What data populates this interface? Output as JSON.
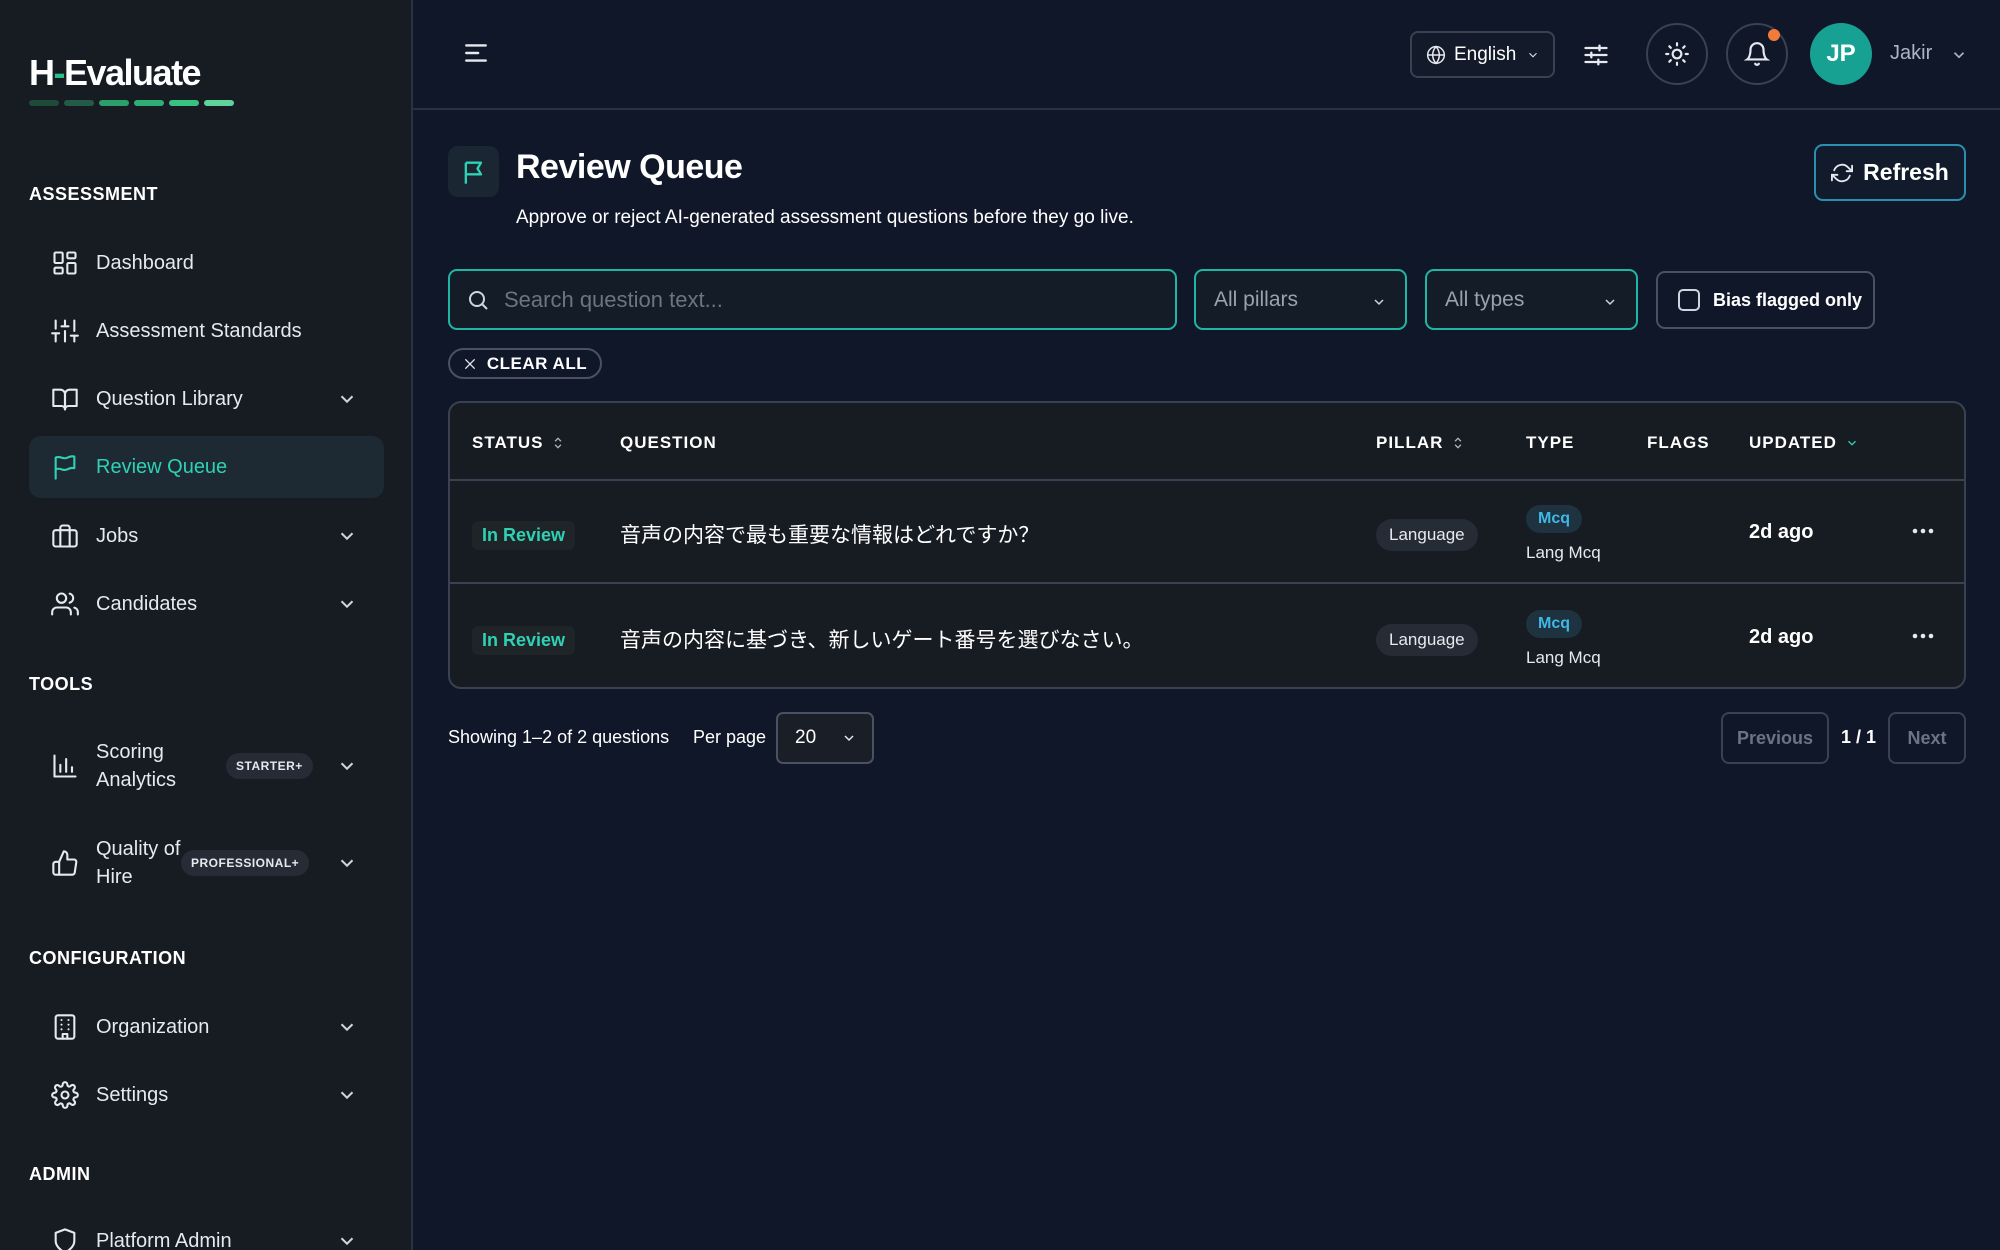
{
  "app": {
    "logo_main": "H",
    "logo_dash": "-",
    "logo_rest": "Evaluate",
    "logo_bar_colors": [
      "#1e4a3a",
      "#235c46",
      "#2a9e6b",
      "#2eae75",
      "#38c283",
      "#5ed39b"
    ]
  },
  "sidebar": {
    "sections": {
      "assessment": "ASSESSMENT",
      "tools": "TOOLS",
      "configuration": "CONFIGURATION",
      "admin": "ADMIN"
    },
    "items": {
      "dashboard": "Dashboard",
      "assessment_standards": "Assessment Standards",
      "question_library": "Question Library",
      "review_queue": "Review Queue",
      "jobs": "Jobs",
      "candidates": "Candidates",
      "scoring_analytics": "Scoring Analytics",
      "scoring_badge": "STARTER+",
      "quality_of_hire": "Quality of Hire",
      "quality_badge": "PROFESSIONAL+",
      "organization": "Organization",
      "settings": "Settings",
      "platform_admin": "Platform Admin"
    }
  },
  "header": {
    "language": "English",
    "avatar_initials": "JP",
    "user_name": "Jakir"
  },
  "page": {
    "title": "Review Queue",
    "subtitle": "Approve or reject AI-generated assessment questions before they go live.",
    "refresh_label": "Refresh"
  },
  "filters": {
    "search_placeholder": "Search question text...",
    "pillars": "All pillars",
    "types": "All types",
    "bias_flagged": "Bias flagged only",
    "clear_all": "CLEAR ALL"
  },
  "table": {
    "columns": {
      "status": "STATUS",
      "question": "QUESTION",
      "pillar": "PILLAR",
      "type": "TYPE",
      "flags": "FLAGS",
      "updated": "UPDATED"
    },
    "rows": [
      {
        "status": "In Review",
        "question": "音声の内容で最も重要な情報はどれですか？",
        "pillar": "Language",
        "type": "Mcq",
        "type_sub": "Lang Mcq",
        "updated": "2d ago"
      },
      {
        "status": "In Review",
        "question": "音声の内容に基づき、新しいゲート番号を選びなさい。",
        "pillar": "Language",
        "type": "Mcq",
        "type_sub": "Lang Mcq",
        "updated": "2d ago"
      }
    ]
  },
  "pagination": {
    "showing": "Showing 1–2 of 2 questions",
    "per_page_label": "Per page",
    "per_page_value": "20",
    "previous": "Previous",
    "page_info": "1 / 1",
    "next": "Next"
  },
  "colors": {
    "accent": "#2fd1b5",
    "notification_dot": "#f47a3a",
    "avatar_bg": "#17a192"
  }
}
